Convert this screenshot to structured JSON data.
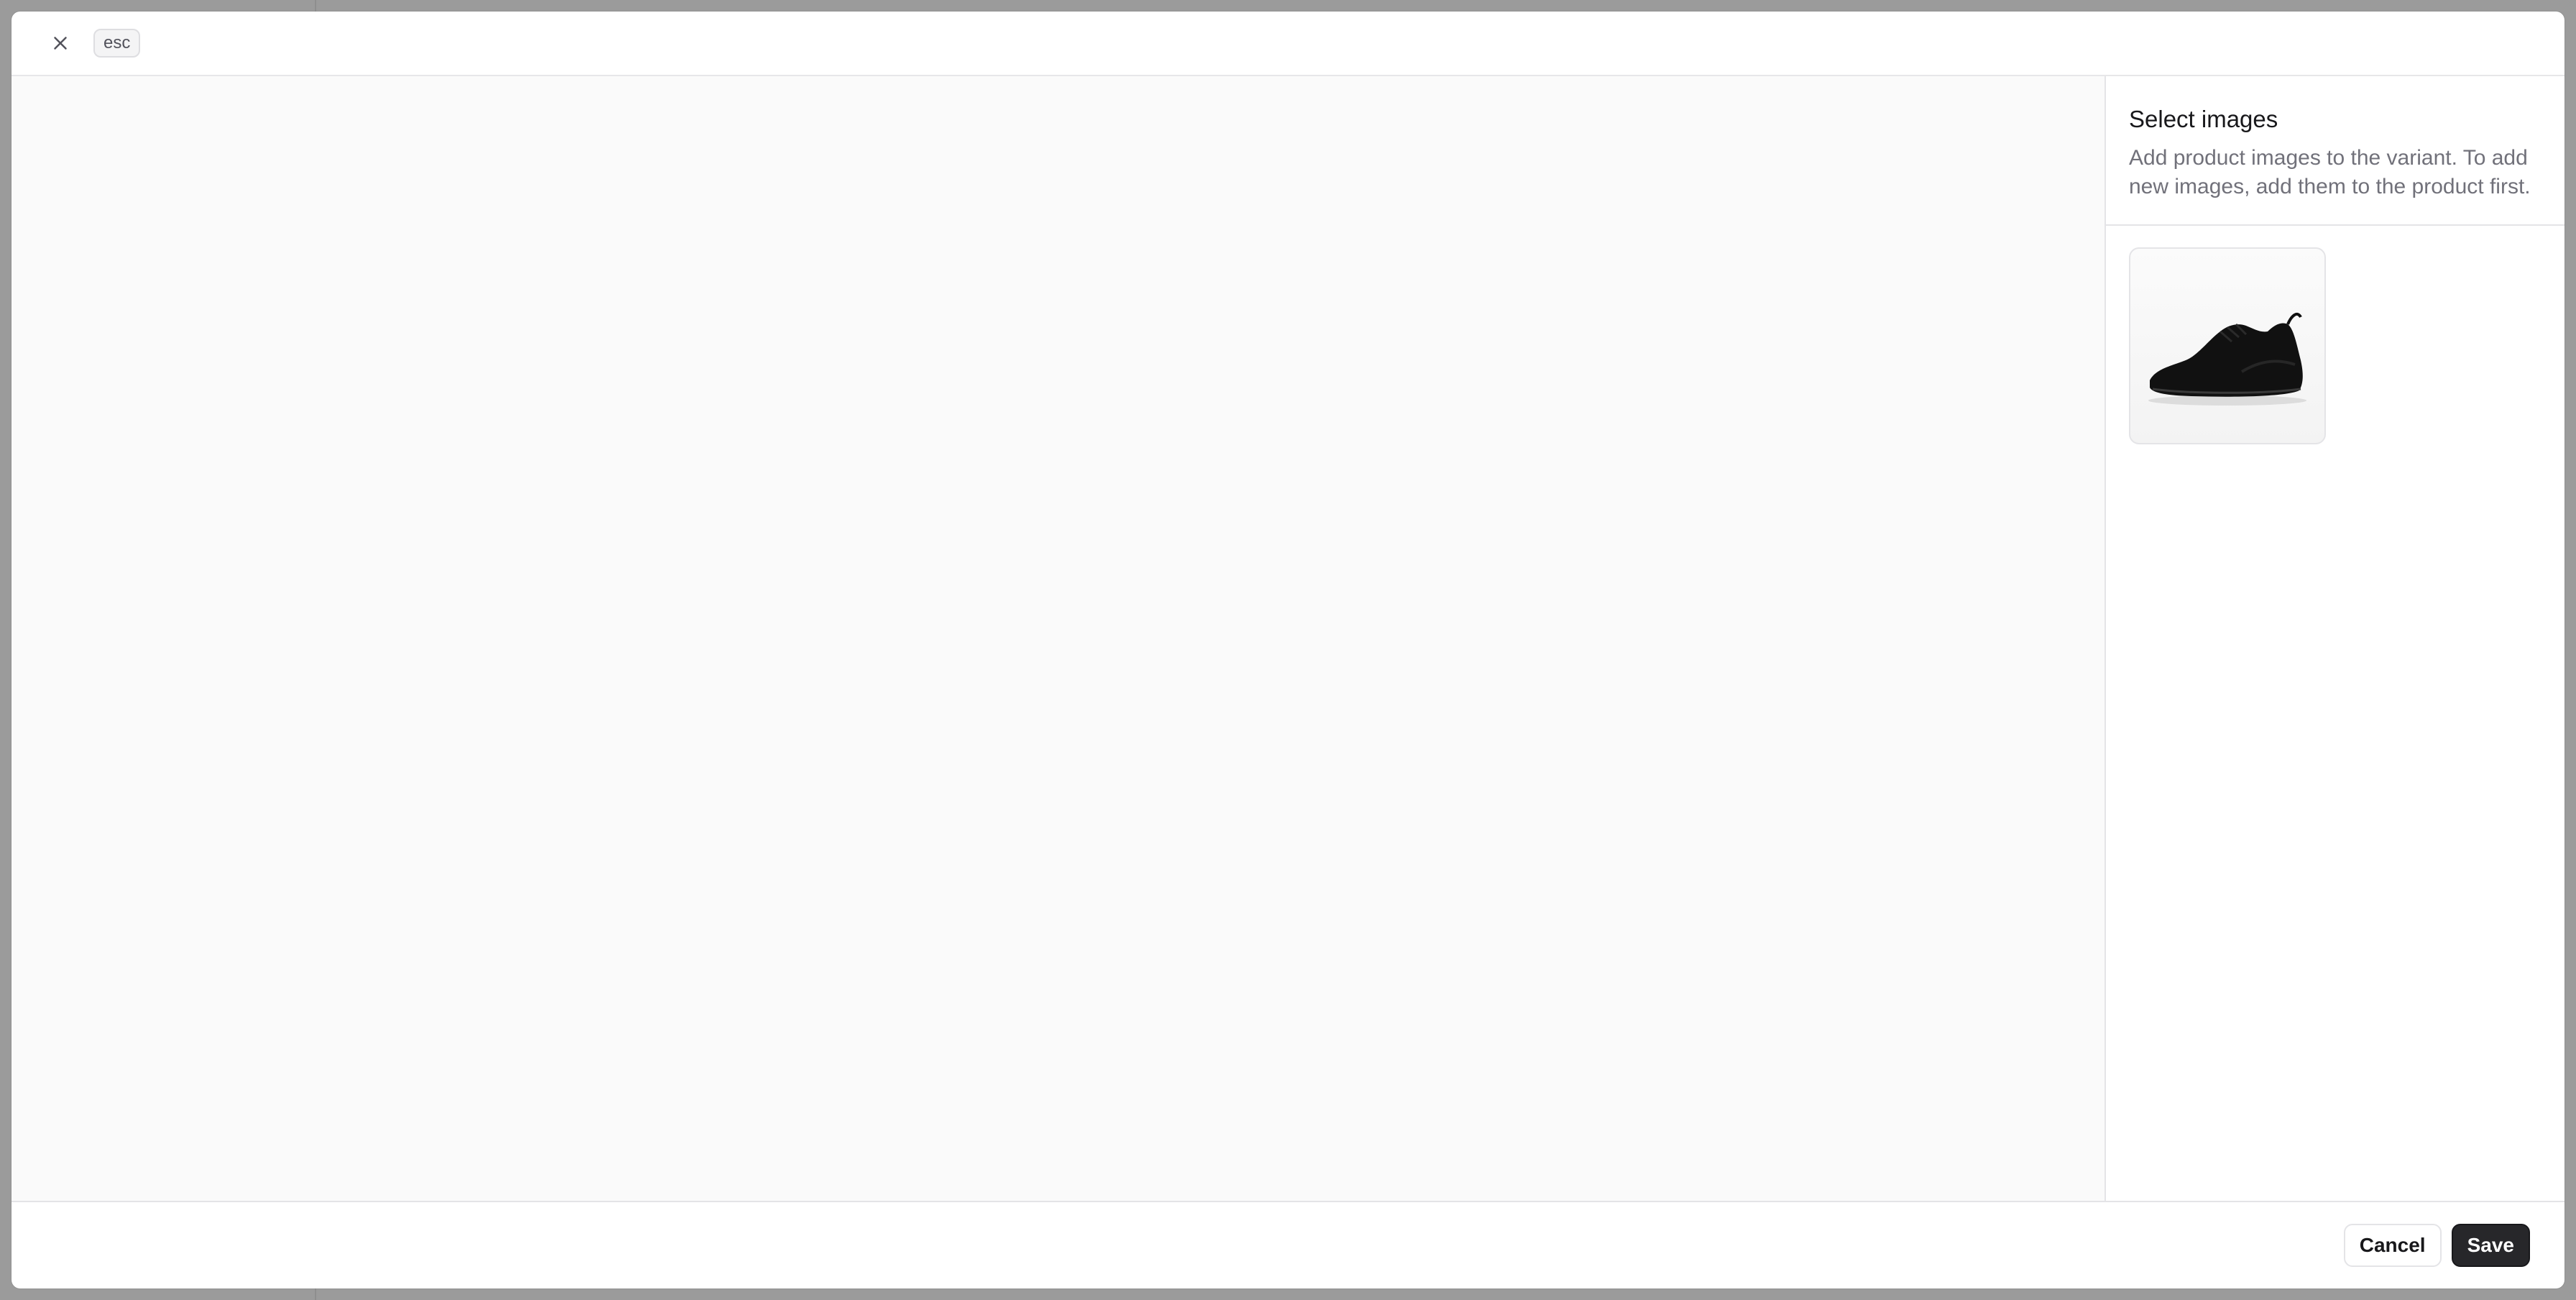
{
  "header": {
    "close_icon": "close-icon",
    "shortcut": "esc"
  },
  "panel": {
    "title": "Select images",
    "description": "Add product images to the variant. To add new images, add them to the product first.",
    "images": [
      {
        "icon": "shoe-image",
        "description": "black sneaker"
      }
    ]
  },
  "footer": {
    "cancel_label": "Cancel",
    "save_label": "Save"
  },
  "colors": {
    "overlay": "#9b9b9b",
    "primary_button": "#27272a",
    "canvas_background": "#fafafa"
  }
}
